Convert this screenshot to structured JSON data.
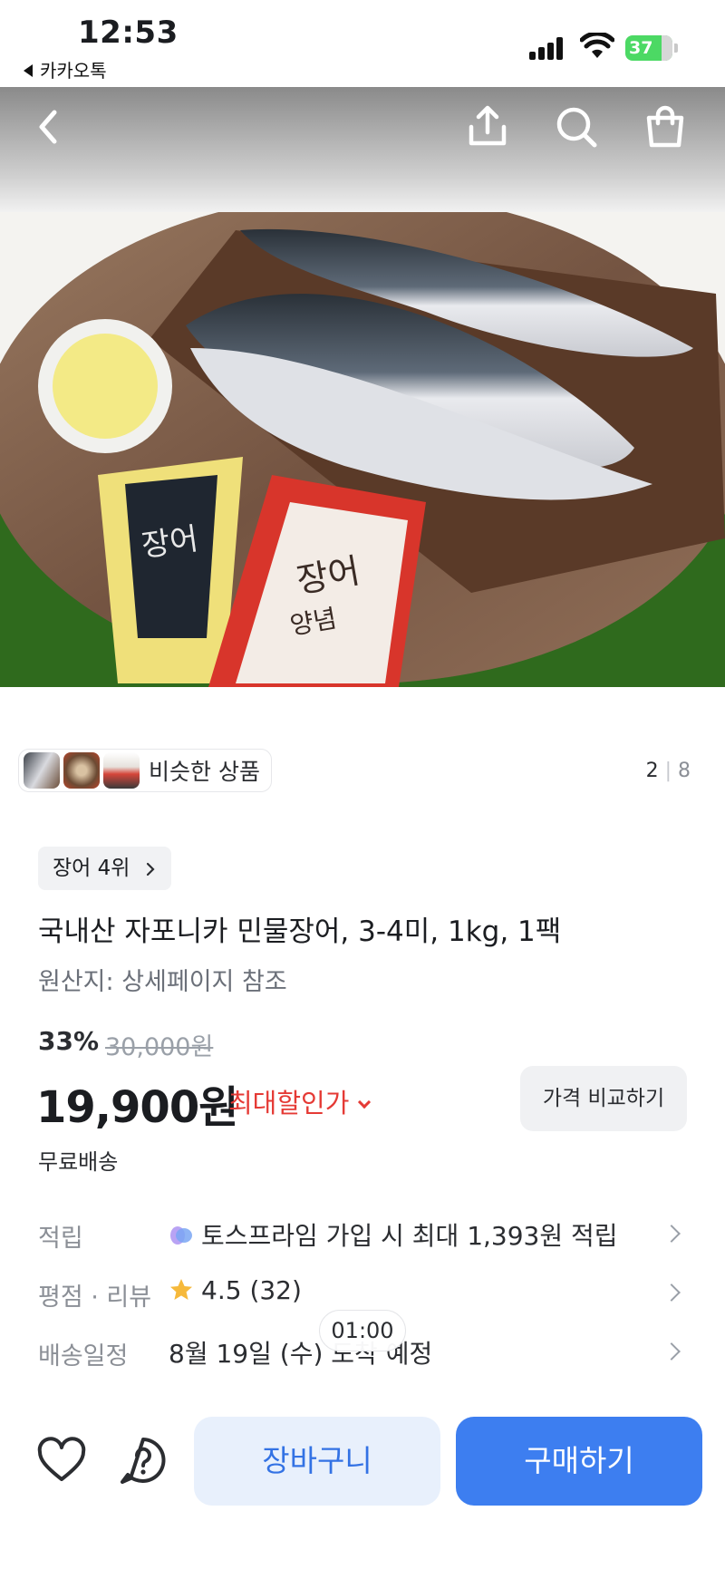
{
  "status_bar": {
    "time": "12:53",
    "back_app": "카카오톡",
    "battery": "37"
  },
  "header": {
    "icons": [
      "back-arrow-icon",
      "share-icon",
      "search-icon",
      "shopping-bag-icon"
    ]
  },
  "product_image": {
    "alt": "장어구이양념"
  },
  "gallery": {
    "similar_label": "비슷한 상품",
    "current_page": "2",
    "page_separator": "|",
    "total_pages": "8"
  },
  "product": {
    "rank_badge": "장어 4위",
    "title": "국내산 자포니카 민물장어, 3-4미, 1kg, 1팩",
    "origin": "원산지: 상세페이지 참조"
  },
  "pricing": {
    "discount_rate": "33%",
    "original_price": "30,000원",
    "price": "19,900원",
    "max_discount_label": "최대할인가",
    "compare_button": "가격 비교하기",
    "shipping": "무료배송"
  },
  "info_rows": [
    {
      "key": "적립",
      "value": "토스프라임 가입 시 최대 1,393원 적립",
      "icon": "toss-prime-icon"
    },
    {
      "key": "평점 · 리뷰",
      "rating": "4.5",
      "reviews": "(32)",
      "icon": "star-icon"
    },
    {
      "key": "배송일정",
      "value": "8월 19일 (수) 도착 예정"
    }
  ],
  "timer": "01:00",
  "bottom_bar": {
    "cart_label": "장바구니",
    "buy_label": "구매하기"
  },
  "colors": {
    "accent_blue": "#3d7ef0",
    "cart_bg": "#e8f0fc",
    "sale_red": "#e53a35",
    "star": "#f6b93b"
  }
}
